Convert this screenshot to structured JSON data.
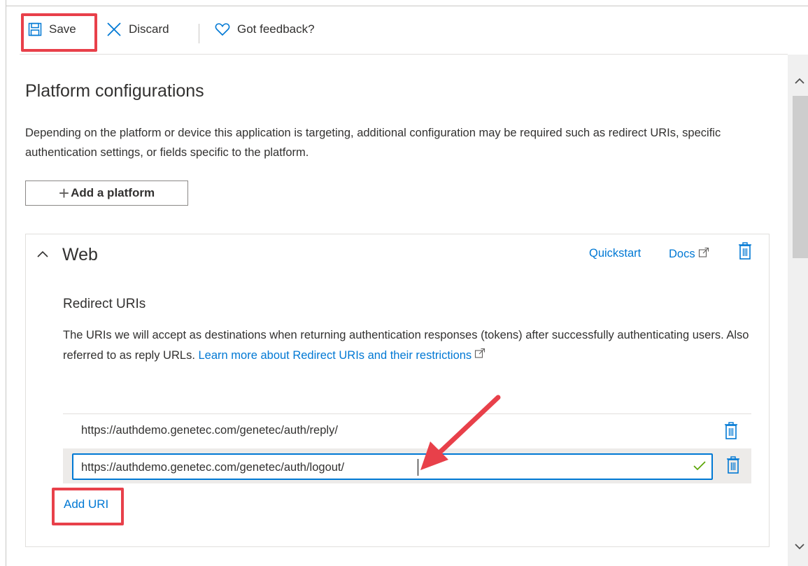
{
  "toolbar": {
    "save_label": "Save",
    "discard_label": "Discard",
    "feedback_label": "Got feedback?"
  },
  "main": {
    "title": "Platform configurations",
    "description": "Depending on the platform or device this application is targeting, additional configuration may be required such as redirect URIs, specific authentication settings, or fields specific to the platform.",
    "add_platform_label": "Add a platform"
  },
  "web_card": {
    "title": "Web",
    "quickstart_label": "Quickstart",
    "docs_label": "Docs",
    "redirect_title": "Redirect URIs",
    "redirect_description": "The URIs we will accept as destinations when returning authentication responses (tokens) after successfully authenticating users. Also referred to as reply URLs. ",
    "learn_more_label": "Learn more about Redirect URIs and their restrictions",
    "uris": [
      "https://authdemo.genetec.com/genetec/auth/reply/"
    ],
    "editing_uri_value": "https://authdemo.genetec.com/genetec/auth/logout/",
    "add_uri_label": "Add URI"
  },
  "colors": {
    "accent": "#0078d4",
    "highlight_annotation": "#e8404a",
    "valid_check": "#57a300"
  },
  "icons": [
    "save-icon",
    "close-icon",
    "heart-icon",
    "plus-icon",
    "chevron-up-icon",
    "external-link-icon",
    "trash-icon",
    "checkmark-icon",
    "scroll-up-icon",
    "scroll-down-icon"
  ]
}
